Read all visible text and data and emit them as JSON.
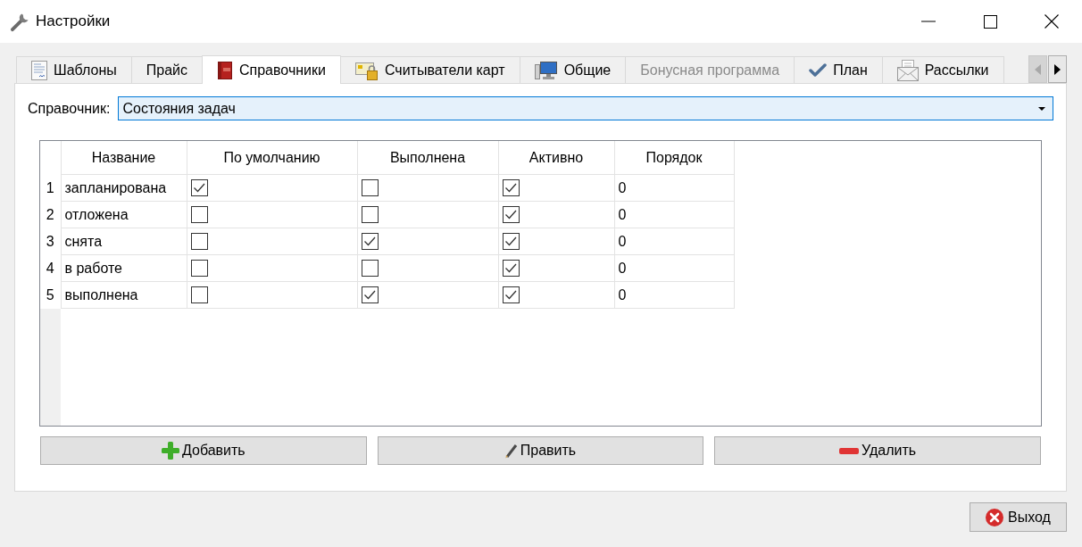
{
  "window": {
    "title": "Настройки"
  },
  "tabs": [
    {
      "label": "Шаблоны",
      "selected": false,
      "disabled": false
    },
    {
      "label": "Прайс",
      "selected": false,
      "disabled": false
    },
    {
      "label": "Справочники",
      "selected": true,
      "disabled": false
    },
    {
      "label": "Считыватели карт",
      "selected": false,
      "disabled": false
    },
    {
      "label": "Общие",
      "selected": false,
      "disabled": false
    },
    {
      "label": "Бонусная программа",
      "selected": false,
      "disabled": true
    },
    {
      "label": "План",
      "selected": false,
      "disabled": false
    },
    {
      "label": "Рассылки",
      "selected": false,
      "disabled": false
    }
  ],
  "tab_scroll_buttons": [
    {
      "kind": "left",
      "disabled": true
    },
    {
      "kind": "right",
      "disabled": false
    }
  ],
  "dropdown": {
    "label": "Справочник:",
    "value": "Состояния задач",
    "focused": true
  },
  "table": {
    "columns": [
      "Название",
      "По умолчанию",
      "Выполнена",
      "Активно",
      "Порядок"
    ],
    "rows": [
      {
        "number": "1",
        "name": "запланирована",
        "default": true,
        "done": false,
        "active": true,
        "order": "0"
      },
      {
        "number": "2",
        "name": "отложена",
        "default": false,
        "done": false,
        "active": true,
        "order": "0"
      },
      {
        "number": "3",
        "name": "снята",
        "default": false,
        "done": true,
        "active": true,
        "order": "0"
      },
      {
        "number": "4",
        "name": "в работе",
        "default": false,
        "done": false,
        "active": true,
        "order": "0"
      },
      {
        "number": "5",
        "name": "выполнена",
        "default": false,
        "done": true,
        "active": true,
        "order": "0"
      }
    ]
  },
  "buttons": [
    {
      "label": "Добавить"
    },
    {
      "label": "Править"
    },
    {
      "label": "Удалить"
    }
  ],
  "exit_button": {
    "label": "Выход"
  }
}
